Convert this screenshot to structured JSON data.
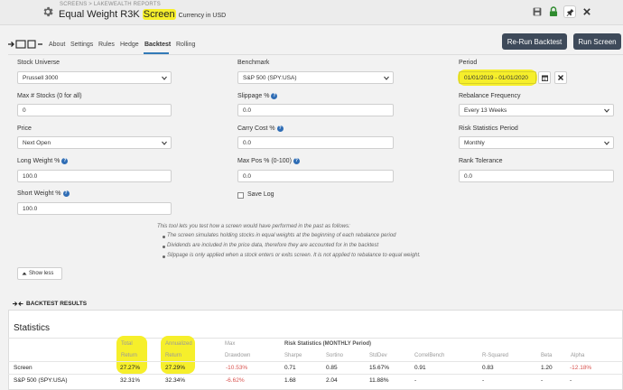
{
  "header": {
    "breadcrumb": "SCREENS > LAKEWEALTH REPORTS",
    "title_main": "Equal Weight R3K ",
    "title_highlight": "Screen",
    "currency": "Currency in USD"
  },
  "icons": {
    "gear": "gear-icon",
    "save": "save-icon",
    "lock": "lock-icon",
    "pin": "pin-icon",
    "close": "close-icon",
    "calendar": "calendar-icon"
  },
  "colors": {
    "button": "#3e4a5a",
    "accent": "#337ab7",
    "negative": "#d9534f",
    "highlight": "#f6ef2b",
    "lock": "#2e8b2e"
  },
  "tabs": [
    {
      "label": "About"
    },
    {
      "label": "Settings"
    },
    {
      "label": "Rules"
    },
    {
      "label": "Hedge"
    },
    {
      "label": "Backtest",
      "active": true
    },
    {
      "label": "Rolling"
    }
  ],
  "buttons": {
    "rerun": "Re-Run Backtest",
    "run": "Run Screen"
  },
  "form": {
    "stock_universe": {
      "label": "Stock Universe",
      "value": "Prussell 3000"
    },
    "benchmark": {
      "label": "Benchmark",
      "value": "S&P 500 (SPY:USA)"
    },
    "period": {
      "label": "Period",
      "value": "01/01/2019 - 01/01/2020"
    },
    "max_stocks": {
      "label": "Max # Stocks (0 for all)",
      "value": "0"
    },
    "slippage": {
      "label": "Slippage %",
      "value": "0.0"
    },
    "rebalance": {
      "label": "Rebalance Frequency",
      "value": "Every 13 Weeks"
    },
    "price": {
      "label": "Price",
      "value": "Next Open"
    },
    "carry_cost": {
      "label": "Carry Cost %",
      "value": "0.0"
    },
    "risk_period": {
      "label": "Risk Statistics Period",
      "value": "Monthly"
    },
    "long_weight": {
      "label": "Long Weight %",
      "value": "100.0"
    },
    "max_pos": {
      "label": "Max Pos % (0-100)",
      "value": "0.0"
    },
    "rank_tolerance": {
      "label": "Rank Tolerance",
      "value": "0.0"
    },
    "short_weight": {
      "label": "Short Weight %",
      "value": "100.0"
    },
    "save_log": {
      "label": "Save Log",
      "checked": false
    }
  },
  "info": {
    "intro": "This tool lets you test how a screen would have performed in the past as follows:",
    "bullets": [
      "The screen simulates holding stocks in equal weights at the beginning of each rebalance period",
      "Dividends are included in the price data, therefore they are accounted for in the backtest",
      "Slippage is only applied when a stock enters or exits screen. It is not applied to rebalance to equal weight."
    ]
  },
  "show_less": "Show less",
  "results": {
    "section_title": "BACKTEST RESULTS",
    "statistics_title": "Statistics",
    "headers": {
      "total_1": "Total",
      "total_2": "Return",
      "ann_1": "Annualized",
      "ann_2": "Return",
      "max_1": "Max",
      "max_2": "Drawdown",
      "risk": "Risk Statistics (MONTHLY Period)",
      "sharpe": "Sharpe",
      "sortino": "Sortino",
      "stddev": "StdDev",
      "correl": "CorrelBench",
      "rsq": "R-Squared",
      "beta": "Beta",
      "alpha": "Alpha"
    },
    "rows": [
      {
        "name": "Screen",
        "total": "27.27%",
        "annualized": "27.29%",
        "drawdown": "-10.53%",
        "sharpe": "0.71",
        "sortino": "0.85",
        "stddev": "15.67%",
        "correl": "0.91",
        "rsq": "0.83",
        "beta": "1.20",
        "alpha": "-12.18%"
      },
      {
        "name": "S&P 500 (SPY:USA)",
        "total": "32.31%",
        "annualized": "32.34%",
        "drawdown": "-6.62%",
        "sharpe": "1.68",
        "sortino": "2.04",
        "stddev": "11.88%",
        "correl": "-",
        "rsq": "-",
        "beta": "-",
        "alpha": "-"
      }
    ]
  }
}
